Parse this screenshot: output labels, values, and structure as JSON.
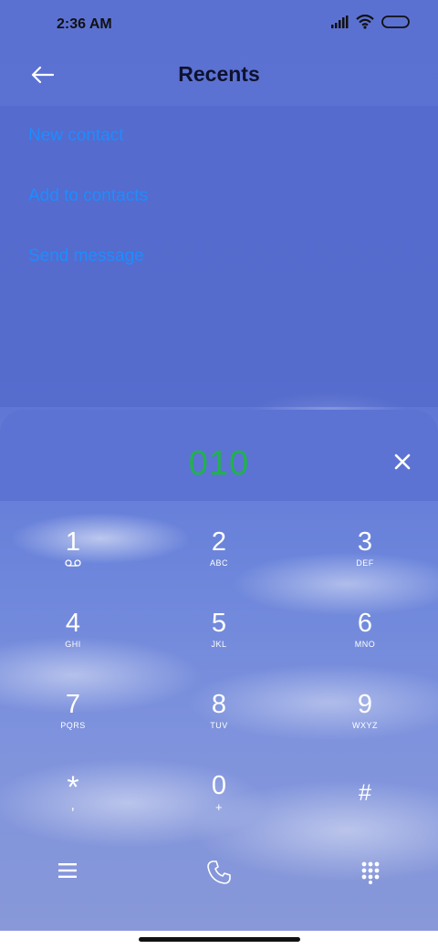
{
  "status": {
    "time": "2:36 AM"
  },
  "header": {
    "title": "Recents"
  },
  "menu": {
    "items": [
      "New contact",
      "Add to contacts",
      "Send message"
    ]
  },
  "dialer": {
    "input_value": "010"
  },
  "keypad": [
    {
      "num": "1",
      "sub": ""
    },
    {
      "num": "2",
      "sub": "ABC"
    },
    {
      "num": "3",
      "sub": "DEF"
    },
    {
      "num": "4",
      "sub": "GHI"
    },
    {
      "num": "5",
      "sub": "JKL"
    },
    {
      "num": "6",
      "sub": "MNO"
    },
    {
      "num": "7",
      "sub": "PQRS"
    },
    {
      "num": "8",
      "sub": "TUV"
    },
    {
      "num": "9",
      "sub": "WXYZ"
    },
    {
      "num": "*",
      "sub": ","
    },
    {
      "num": "0",
      "sub": "+"
    },
    {
      "num": "#",
      "sub": ""
    }
  ],
  "colors": {
    "accent": "#1e8cff",
    "digits": "#20b34a",
    "panel": "#5c73d4"
  }
}
